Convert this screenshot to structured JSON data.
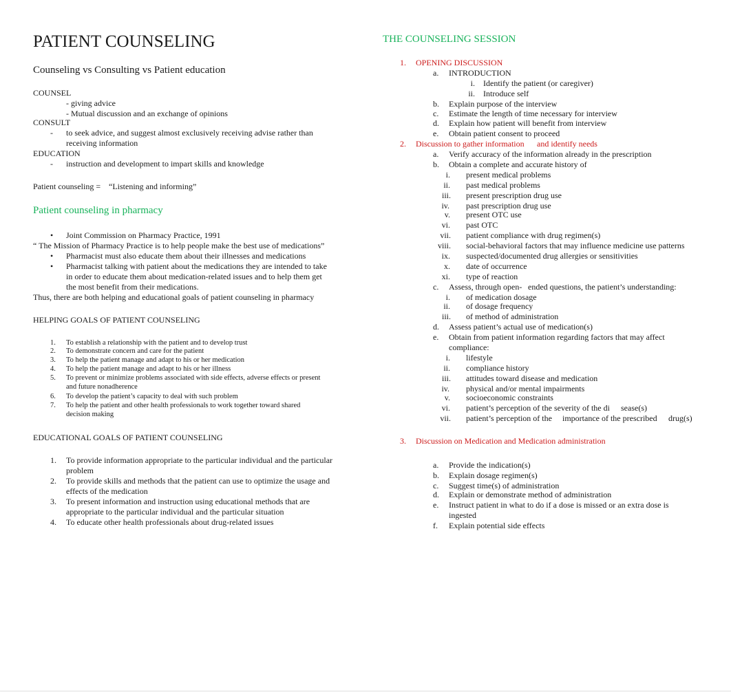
{
  "left": {
    "title": "PATIENT COUNSELING",
    "subtitle": "Counseling vs Consulting vs Patient education",
    "counsel": {
      "heading": "COUNSEL",
      "items": [
        "- giving advice",
        "- Mutual discussion and an exchange of opinions"
      ]
    },
    "consult": {
      "heading": "CONSULT",
      "bullet": "-",
      "lines": [
        "to seek advice, and suggest almost exclusively receiving advise rather than",
        "receiving information"
      ]
    },
    "education": {
      "heading": "EDUCATION",
      "bullet": "-",
      "line": "instruction and development to impart skills and knowledge"
    },
    "definition": {
      "label": "Patient counseling =",
      "value": "“Listening and informing”"
    },
    "pharmacy": {
      "heading": "Patient counseling in pharmacy",
      "bullet": "•",
      "item1": "Joint Commission on Pharmacy Practice, 1991",
      "mission": "“ The Mission of Pharmacy Practice is to help people make the best use of medications”",
      "item2": "Pharmacist must also educate them about their illnesses and medications",
      "item3_lines": [
        "Pharmacist talking with patient about the medications they are intended to take",
        "in order to educate them about medication-related issues and to help them get",
        "the most benefit from their medications."
      ],
      "conclusion": "Thus, there are both helping and educational goals of patient counseling in pharmacy"
    },
    "helping_goals": {
      "heading": "HELPING GOALS OF PATIENT COUNSELING",
      "items": [
        {
          "num": "1.",
          "lines": [
            "To establish a relationship with the patient and to develop trust"
          ]
        },
        {
          "num": "2.",
          "lines": [
            "To demonstrate concern and care for the patient"
          ]
        },
        {
          "num": "3.",
          "lines": [
            "To help the patient manage and adapt to his or her medication"
          ]
        },
        {
          "num": "4.",
          "lines": [
            "To help the patient manage and adapt to his or her illness"
          ]
        },
        {
          "num": "5.",
          "lines": [
            "To prevent or minimize problems associated with side effects, adverse effects or present",
            "and future nonadherence"
          ]
        },
        {
          "num": "6.",
          "lines": [
            "To develop the patient’s capacity to deal with such problem"
          ]
        },
        {
          "num": "7.",
          "lines": [
            "To help the patient and other health professionals to work together toward shared",
            "decision making"
          ]
        }
      ]
    },
    "educational_goals": {
      "heading": "EDUCATIONAL GOALS OF PATIENT COUNSELING",
      "items": [
        {
          "num": "1.",
          "lines": [
            "To provide information appropriate to the particular individual and the particular",
            "problem"
          ]
        },
        {
          "num": "2.",
          "lines": [
            "To provide skills and methods that the patient can use to optimize the usage and",
            "effects of the medication"
          ]
        },
        {
          "num": "3.",
          "lines": [
            "To present information and instruction using educational methods that are",
            "appropriate to the particular individual and the particular situation"
          ]
        },
        {
          "num": "4.",
          "lines": [
            "To educate other health professionals about drug-related issues"
          ]
        }
      ]
    }
  },
  "right": {
    "title": "THE COUNSELING SESSION",
    "section1": {
      "num": "1.",
      "heading": "OPENING DISCUSSION",
      "a": {
        "label": "a.",
        "text": "INTRODUCTION",
        "subs": [
          {
            "label": "i.",
            "text": "Identify the patient (or caregiver)"
          },
          {
            "label": "ii.",
            "text": "Introduce self"
          }
        ]
      },
      "rest": [
        {
          "label": "b.",
          "text": "Explain purpose of the interview"
        },
        {
          "label": "c.",
          "text": "Estimate the length of time necessary for interview"
        },
        {
          "label": "d.",
          "text": "Explain how patient will benefit from interview"
        },
        {
          "label": "e.",
          "text": "Obtain patient consent to proceed"
        }
      ]
    },
    "section2": {
      "num": "2.",
      "heading_part1": "Discussion to gather information",
      "heading_part2": "and identify needs",
      "a": {
        "label": "a.",
        "text": "Verify accuracy of the information already in the prescription"
      },
      "b": {
        "label": "b.",
        "text": "Obtain a complete and accurate history of",
        "subs": [
          {
            "label": "i.",
            "text": "present medical problems"
          },
          {
            "label": "ii.",
            "text": "past medical problems"
          },
          {
            "label": "iii.",
            "text": "present prescription drug use"
          },
          {
            "label": "iv.",
            "text": "past prescription drug use"
          },
          {
            "label": "v.",
            "text": "present OTC use"
          },
          {
            "label": "vi.",
            "text": "past OTC"
          },
          {
            "label": "vii.",
            "text": "patient compliance with drug regimen(s)"
          },
          {
            "label": "viii.",
            "text": "social-behavioral factors that may influence medicine use patterns"
          },
          {
            "label": "ix.",
            "text": "suspected/documented drug allergies or sensitivities"
          },
          {
            "label": "x.",
            "text": "date of occurrence"
          },
          {
            "label": "xi.",
            "text": "type of reaction"
          }
        ]
      },
      "c": {
        "label": "c.",
        "text_part1": "Assess, through open-",
        "text_part2": "ended questions, the patient’s understanding:",
        "subs": [
          {
            "label": "i.",
            "text": "of medication dosage"
          },
          {
            "label": "ii.",
            "text": "of dosage frequency"
          },
          {
            "label": "iii.",
            "text": "of method of administration"
          }
        ]
      },
      "d": {
        "label": "d.",
        "text": "Assess patient’s actual use of medication(s)"
      },
      "e": {
        "label": "e.",
        "lines": [
          "Obtain from patient information regarding factors that may affect",
          "compliance:"
        ],
        "subs": [
          {
            "label": "i.",
            "text": "lifestyle"
          },
          {
            "label": "ii.",
            "text": "compliance history"
          },
          {
            "label": "iii.",
            "text": "attitudes toward disease and medication"
          },
          {
            "label": "iv.",
            "text": "physical and/or mental impairments"
          },
          {
            "label": "v.",
            "text": "socioeconomic constraints"
          },
          {
            "label": "vi.",
            "text": "patient’s perception of the severity of the di",
            "text2": "sease(s)"
          },
          {
            "label": "vii.",
            "text": "patient’s perception of the",
            "text2": "importance of the prescribed",
            "text3": "drug(s)"
          }
        ]
      }
    },
    "section3": {
      "num": "3.",
      "heading": "Discussion on Medication and Medication administration",
      "items": [
        {
          "label": "a.",
          "lines": [
            "Provide the indication(s)"
          ]
        },
        {
          "label": "b.",
          "lines": [
            "Explain dosage regimen(s)"
          ]
        },
        {
          "label": "c.",
          "lines": [
            "Suggest time(s) of administration"
          ]
        },
        {
          "label": "d.",
          "lines": [
            "Explain or demonstrate method of administration"
          ]
        },
        {
          "label": "e.",
          "lines": [
            "Instruct patient in what to do if a dose is missed or an extra dose is",
            "ingested"
          ]
        },
        {
          "label": "f.",
          "lines": [
            "Explain potential side effects"
          ]
        }
      ]
    }
  },
  "colors": {
    "heading_green": "#17b25a",
    "heading_red": "#cc1a1a",
    "text": "#1a1a1a"
  }
}
